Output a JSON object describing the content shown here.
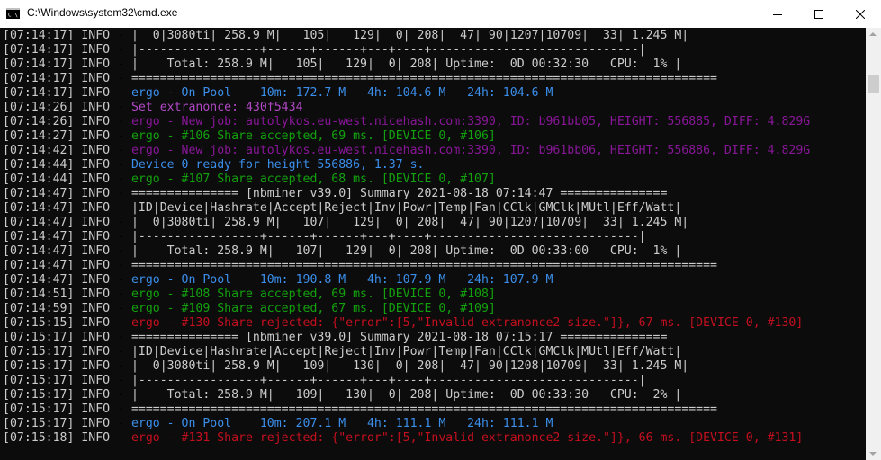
{
  "window": {
    "title": "C:\\Windows\\system32\\cmd.exe",
    "icon": "cmd-icon",
    "controls": [
      "minimize-icon",
      "maximize-icon",
      "close-icon"
    ]
  },
  "colors": {
    "info": "#cccccc",
    "pool": "#3b8eea",
    "extranonce": "#b148c6",
    "job": "#881798",
    "accepted": "#13a10e",
    "ready": "#3b8eea",
    "rejected": "#c50f1f"
  },
  "lines": [
    {
      "ts": "[07:14:17]",
      "level": "INFO",
      "text": "|  0|3080ti| 258.9 M|   105|   129|  0| 208|  47| 90|1207|10709|  33| 1.245 M|",
      "color": "#cccccc"
    },
    {
      "ts": "[07:14:17]",
      "level": "INFO",
      "text": "|-----------------+------+------+---+----+-----------------------------|",
      "color": "#cccccc"
    },
    {
      "ts": "[07:14:17]",
      "level": "INFO",
      "text": "|    Total: 258.9 M|   105|   129|  0| 208| Uptime:  0D 00:32:30   CPU:  1% |",
      "color": "#cccccc"
    },
    {
      "ts": "[07:14:17]",
      "level": "INFO",
      "text": "==================================================================================",
      "color": "#cccccc"
    },
    {
      "ts": "[07:14:17]",
      "level": "INFO",
      "text": "ergo - On Pool    10m: 172.7 M   4h: 104.6 M   24h: 104.6 M",
      "color": "#3b8eea"
    },
    {
      "ts": "[07:14:26]",
      "level": "INFO",
      "text": "Set extranonce: 430f5434",
      "color": "#b148c6"
    },
    {
      "ts": "[07:14:26]",
      "level": "INFO",
      "text": "ergo - New job: autolykos.eu-west.nicehash.com:3390, ID: b961bb05, HEIGHT: 556885, DIFF: 4.829G",
      "color": "#881798"
    },
    {
      "ts": "[07:14:27]",
      "level": "INFO",
      "text": "ergo - #106 Share accepted, 69 ms. [DEVICE 0, #106]",
      "color": "#13a10e"
    },
    {
      "ts": "[07:14:42]",
      "level": "INFO",
      "text": "ergo - New job: autolykos.eu-west.nicehash.com:3390, ID: b961bb06, HEIGHT: 556886, DIFF: 4.829G",
      "color": "#881798"
    },
    {
      "ts": "[07:14:44]",
      "level": "INFO",
      "text": "Device 0 ready for height 556886, 1.37 s.",
      "color": "#3b8eea"
    },
    {
      "ts": "[07:14:44]",
      "level": "INFO",
      "text": "ergo - #107 Share accepted, 68 ms. [DEVICE 0, #107]",
      "color": "#13a10e"
    },
    {
      "ts": "[07:14:47]",
      "level": "INFO",
      "text": "=============== [nbminer v39.0] Summary 2021-08-18 07:14:47 ===============",
      "color": "#cccccc"
    },
    {
      "ts": "[07:14:47]",
      "level": "INFO",
      "text": "|ID|Device|Hashrate|Accept|Reject|Inv|Powr|Temp|Fan|CClk|GMClk|MUtl|Eff/Watt|",
      "color": "#cccccc"
    },
    {
      "ts": "[07:14:47]",
      "level": "INFO",
      "text": "|  0|3080ti| 258.9 M|   107|   129|  0| 208|  47| 90|1207|10709|  33| 1.245 M|",
      "color": "#cccccc"
    },
    {
      "ts": "[07:14:47]",
      "level": "INFO",
      "text": "|-----------------+------+------+---+----+-----------------------------|",
      "color": "#cccccc"
    },
    {
      "ts": "[07:14:47]",
      "level": "INFO",
      "text": "|    Total: 258.9 M|   107|   129|  0| 208| Uptime:  0D 00:33:00   CPU:  1% |",
      "color": "#cccccc"
    },
    {
      "ts": "[07:14:47]",
      "level": "INFO",
      "text": "==================================================================================",
      "color": "#cccccc"
    },
    {
      "ts": "[07:14:47]",
      "level": "INFO",
      "text": "ergo - On Pool    10m: 190.8 M   4h: 107.9 M   24h: 107.9 M",
      "color": "#3b8eea"
    },
    {
      "ts": "[07:14:51]",
      "level": "INFO",
      "text": "ergo - #108 Share accepted, 69 ms. [DEVICE 0, #108]",
      "color": "#13a10e"
    },
    {
      "ts": "[07:14:59]",
      "level": "INFO",
      "text": "ergo - #109 Share accepted, 67 ms. [DEVICE 0, #109]",
      "color": "#13a10e"
    },
    {
      "ts": "[07:15:15]",
      "level": "INFO",
      "text": "ergo - #130 Share rejected: {\"error\":[5,\"Invalid extranonce2 size.\"]}, 67 ms. [DEVICE 0, #130]",
      "color": "#c50f1f"
    },
    {
      "ts": "[07:15:17]",
      "level": "INFO",
      "text": "=============== [nbminer v39.0] Summary 2021-08-18 07:15:17 ===============",
      "color": "#cccccc"
    },
    {
      "ts": "[07:15:17]",
      "level": "INFO",
      "text": "|ID|Device|Hashrate|Accept|Reject|Inv|Powr|Temp|Fan|CClk|GMClk|MUtl|Eff/Watt|",
      "color": "#cccccc"
    },
    {
      "ts": "[07:15:17]",
      "level": "INFO",
      "text": "|  0|3080ti| 258.9 M|   109|   130|  0| 208|  47| 90|1208|10709|  33| 1.245 M|",
      "color": "#cccccc"
    },
    {
      "ts": "[07:15:17]",
      "level": "INFO",
      "text": "|-----------------+------+------+---+----+-----------------------------|",
      "color": "#cccccc"
    },
    {
      "ts": "[07:15:17]",
      "level": "INFO",
      "text": "|    Total: 258.9 M|   109|   130|  0| 208| Uptime:  0D 00:33:30   CPU:  2% |",
      "color": "#cccccc"
    },
    {
      "ts": "[07:15:17]",
      "level": "INFO",
      "text": "==================================================================================",
      "color": "#cccccc"
    },
    {
      "ts": "[07:15:17]",
      "level": "INFO",
      "text": "ergo - On Pool    10m: 207.1 M   4h: 111.1 M   24h: 111.1 M",
      "color": "#3b8eea"
    },
    {
      "ts": "[07:15:18]",
      "level": "INFO",
      "text": "ergo - #131 Share rejected: {\"error\":[5,\"Invalid extranonce2 size.\"]}, 66 ms. [DEVICE 0, #131]",
      "color": "#c50f1f"
    }
  ]
}
